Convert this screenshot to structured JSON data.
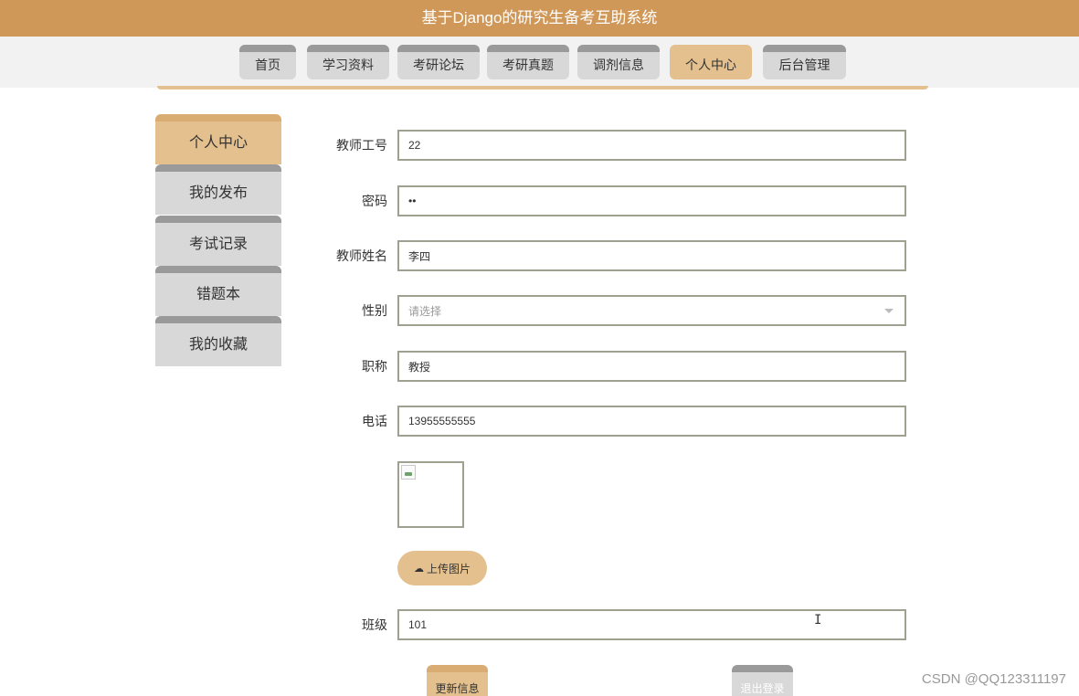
{
  "header": {
    "title": "基于Django的研究生备考互助系统"
  },
  "nav": {
    "items": [
      {
        "label": "首页"
      },
      {
        "label": "学习资料"
      },
      {
        "label": "考研论坛"
      },
      {
        "label": "考研真题"
      },
      {
        "label": "调剂信息"
      },
      {
        "label": "个人中心",
        "active": true
      },
      {
        "label": "后台管理"
      }
    ]
  },
  "sidebar": {
    "items": [
      {
        "label": "个人中心",
        "active": true
      },
      {
        "label": "我的发布"
      },
      {
        "label": "考试记录"
      },
      {
        "label": "错题本"
      },
      {
        "label": "我的收藏"
      }
    ]
  },
  "form": {
    "teacher_id": {
      "label": "教师工号",
      "value": "22"
    },
    "password": {
      "label": "密码",
      "value": "••"
    },
    "teacher_name": {
      "label": "教师姓名",
      "value": "李四"
    },
    "gender": {
      "label": "性别",
      "placeholder": "请选择"
    },
    "title": {
      "label": "职称",
      "value": "教授"
    },
    "phone": {
      "label": "电话",
      "value": "13955555555"
    },
    "upload_label": "上传图片",
    "class_field": {
      "label": "班级",
      "value": "101"
    }
  },
  "actions": {
    "update": "更新信息",
    "logout": "退出登录"
  },
  "watermark": "CSDN @QQ123311197",
  "colors": {
    "header": "#d09858",
    "accent": "#e3c08d",
    "inactive": "#d8d8d8",
    "tab_top": "#9a9a9a"
  },
  "icons": {
    "upload": "cloud-upload-icon",
    "select": "chevron-down-icon",
    "cursor": "text-cursor-icon"
  }
}
